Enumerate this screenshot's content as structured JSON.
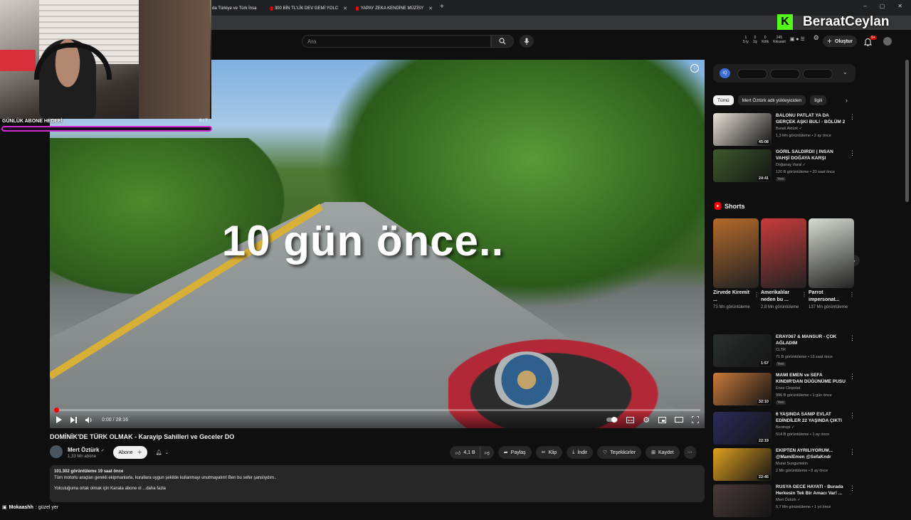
{
  "browser": {
    "tabs": [
      {
        "label": "da Türkiye ve Türk İnsa"
      },
      {
        "label": "300 BİN TL'LİK DEV GEMİ YOLC"
      },
      {
        "label": "YAPAY ZEKA KENDİNE MÜZİSY"
      }
    ],
    "new_tab": "+",
    "window_controls": [
      "–",
      "▢",
      "✕"
    ]
  },
  "header": {
    "search_placeholder": "Ara",
    "ext_stats": [
      {
        "num": "1",
        "label": "5 iy"
      },
      {
        "num": "0",
        "label": "1iy"
      },
      {
        "num": "0",
        "label": "Kötk"
      },
      {
        "num": "245",
        "label": "Kikuasit"
      }
    ],
    "create_label": "Oluştur",
    "notif_count": "9+"
  },
  "stream": {
    "sub_goal_label": "GÜNLÜK ABONE HEDEFİ",
    "sub_goal_count": "0 / 7",
    "sub_goal_progress": 0.0,
    "kick_logo": "K",
    "streamer_name": "BeraatCeylan",
    "chat_user": "Mokaashh",
    "chat_message": ": güzel yer"
  },
  "player": {
    "overlay_text": "10 gün önce..",
    "time": "0:00 / 28:16",
    "progress": 0.0
  },
  "video": {
    "title": "DOMİNİK'DE TÜRK OLMAK - Karayip Sahilleri ve Geceler DO",
    "channel": "Mert Öztürk",
    "subs": "1,33 Mn abone",
    "subscribe_label": "Abone",
    "likes": "4,1 B",
    "share": "Paylaş",
    "clip": "Klip",
    "download": "İndir",
    "thanks": "Teşekkürler",
    "save": "Kaydet",
    "desc_stats": "101.302 görüntüleme  19 saat önce",
    "desc_line1": "Tüm motorlu araçları gerekli ekipmanlarla, kurallara uygun şekilde kullanmayı unutmayalım! Ben bu sefer şanslıydım..",
    "desc_line2": "Yolculuğuma ortak olmak için Kanala abone ol  ...daha fazla"
  },
  "sidebar": {
    "filters": [
      "Tümü",
      "Mert Öztürk adlı yükleyiciden",
      "İlgili"
    ],
    "recommendations_top": [
      {
        "title": "BALONU PATLAT YA DA GERÇEK AŞKI BUL! - BÖLÜM 2",
        "channel": "Burak Aktürk ✓",
        "meta": "1,3 Mn görüntüleme • 2 ay önce",
        "duration": "45:08",
        "badge": "",
        "color": "#e8e2d8"
      },
      {
        "title": "GORİL SALDIRDI! | İNSAN VAHŞİ DOĞAYA KARŞI",
        "channel": "Doğanay Vural ✓",
        "meta": "120 B görüntüleme • 20 saat önce",
        "duration": "24:41",
        "badge": "Yeni",
        "color": "#3d5a2c"
      }
    ],
    "shorts_title": "Shorts",
    "shorts": [
      {
        "title": "Zirvede Kiremit ...",
        "views": "73 Mn görüntüleme",
        "color": "#b46a2a"
      },
      {
        "title": "Amerikalılar neden bu ...",
        "views": "2,8 Mn görüntüleme",
        "color": "#c83b3b"
      },
      {
        "title": "Parrot impersonat...",
        "views": "137 Mn görüntüleme",
        "color": "#d7dcd2"
      }
    ],
    "recommendations_bottom": [
      {
        "title": "ERAY067 & MANSUR - ÇOK AĞLADIM",
        "channel": "CLTR",
        "meta": "71 B görüntüleme • 13 saat önce",
        "duration": "1:57",
        "badge": "Yeni",
        "color": "#2a2f2e"
      },
      {
        "title": "MAMİ EMEN ve SEFA KINDIR'DAN DÜĞÜNÜME PUSU",
        "channel": "Enes Cinpolat",
        "meta": "996 B görüntüleme • 1 gün önce",
        "duration": "32:10",
        "badge": "Yeni",
        "color": "#c97a3a"
      },
      {
        "title": "6 YAŞINDA SANIP EVLAT EDİNDİLER 22 YAŞINDA ÇIKTI",
        "channel": "Bentropi ✓",
        "meta": "514 B görüntüleme • 1 ay önce",
        "duration": "22:19",
        "badge": "",
        "color": "#2c2a5a"
      },
      {
        "title": "EKİPTEN AYRILIYORUM... @MamiEmen @SefaKndr",
        "channel": "Murat Sungurtekin",
        "meta": "2 Mn görüntüleme • 8 ay önce",
        "duration": "22:45",
        "badge": "",
        "color": "#e0a020"
      },
      {
        "title": "RUSYA GECE HAYATI - Burada Herkesin Tek Bir Amacı Var! ...",
        "channel": "Mert Öztürk ✓",
        "meta": "5,7 Mn görüntüleme • 1 yıl önce",
        "duration": "",
        "badge": "",
        "color": "#4a3a3a"
      }
    ]
  }
}
